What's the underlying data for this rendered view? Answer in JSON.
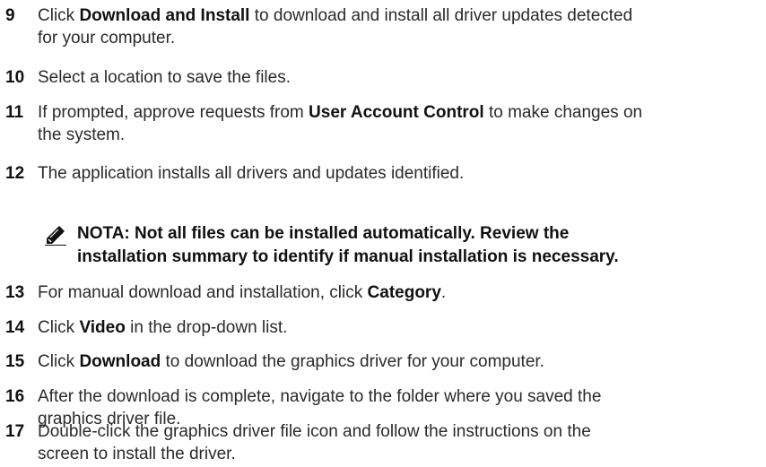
{
  "steps": [
    {
      "number": "9",
      "parts": [
        "Click ",
        "Download and Install",
        " to download and install all driver updates detected",
        "for your computer."
      ]
    },
    {
      "number": "10",
      "text": "Select a location to save the files."
    },
    {
      "number": "11",
      "parts": [
        "If prompted, approve requests from ",
        "User Account Control",
        " to make changes on",
        "the system."
      ]
    },
    {
      "number": "12",
      "text": "The application installs all drivers and updates identified."
    },
    {
      "number": "13",
      "parts": [
        "For manual download and installation, click ",
        "Category",
        "."
      ]
    },
    {
      "number": "14",
      "parts": [
        "Click ",
        "Video",
        " in the drop-down list."
      ]
    },
    {
      "number": "15",
      "parts": [
        "Click ",
        "Download",
        " to download the graphics driver for your computer."
      ]
    },
    {
      "number": "16",
      "lines": [
        "After the download is complete, navigate to the folder where you saved the",
        "graphics driver file."
      ]
    },
    {
      "number": "17",
      "lines": [
        "Double-click the graphics driver file icon and follow the instructions on the",
        "screen to install the driver."
      ]
    }
  ],
  "note": {
    "icon": "pencil-note-icon",
    "lines": [
      "NOTA: Not all files can be installed automatically. Review the",
      "installation summary to identify if manual installation is necessary."
    ]
  }
}
